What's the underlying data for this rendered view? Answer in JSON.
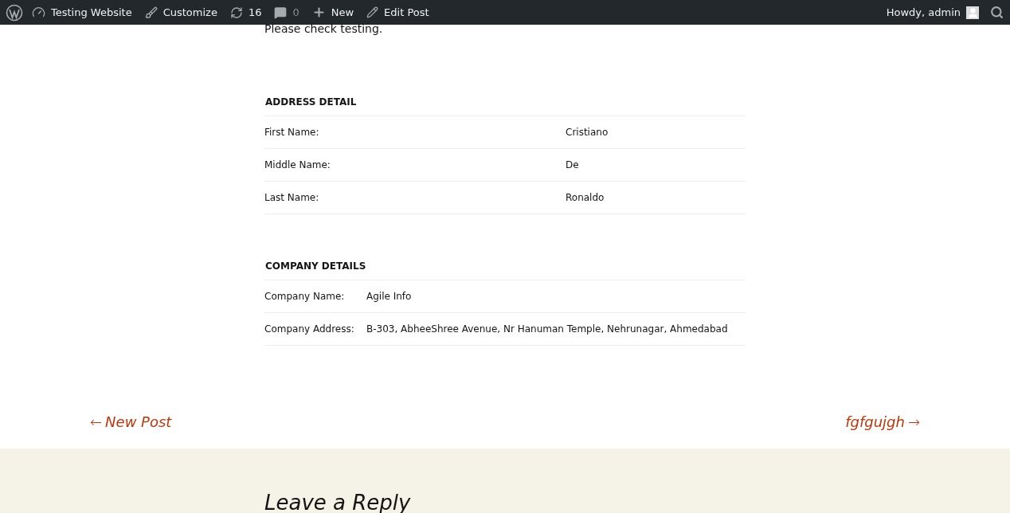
{
  "admin_bar": {
    "site": "Testing Website",
    "customize": "Customize",
    "updates": "16",
    "comments": "0",
    "new": "New",
    "edit": "Edit Post",
    "greeting": "Howdy, admin"
  },
  "post": {
    "text": "Please check testing.",
    "sections": [
      {
        "kind": "wide",
        "title": "ADDRESS DETAIL",
        "rows": [
          {
            "label": "First Name:",
            "value": "Cristiano"
          },
          {
            "label": "Middle Name:",
            "value": "De"
          },
          {
            "label": "Last Name:",
            "value": "Ronaldo"
          }
        ]
      },
      {
        "kind": "compact",
        "title": "COMPANY DETAILS",
        "rows": [
          {
            "label": "Company Name:",
            "value": "Agile Info"
          },
          {
            "label": "Company Address:",
            "value": "B-303, AbheeShree Avenue, Nr Hanuman Temple, Nehrunagar, Ahmedabad"
          }
        ]
      }
    ]
  },
  "nav": {
    "previous": {
      "arrow": "←",
      "label": "New Post"
    },
    "next": {
      "label": "fgfgujgh",
      "arrow": "→"
    }
  },
  "reply": {
    "title": "Leave a Reply"
  }
}
